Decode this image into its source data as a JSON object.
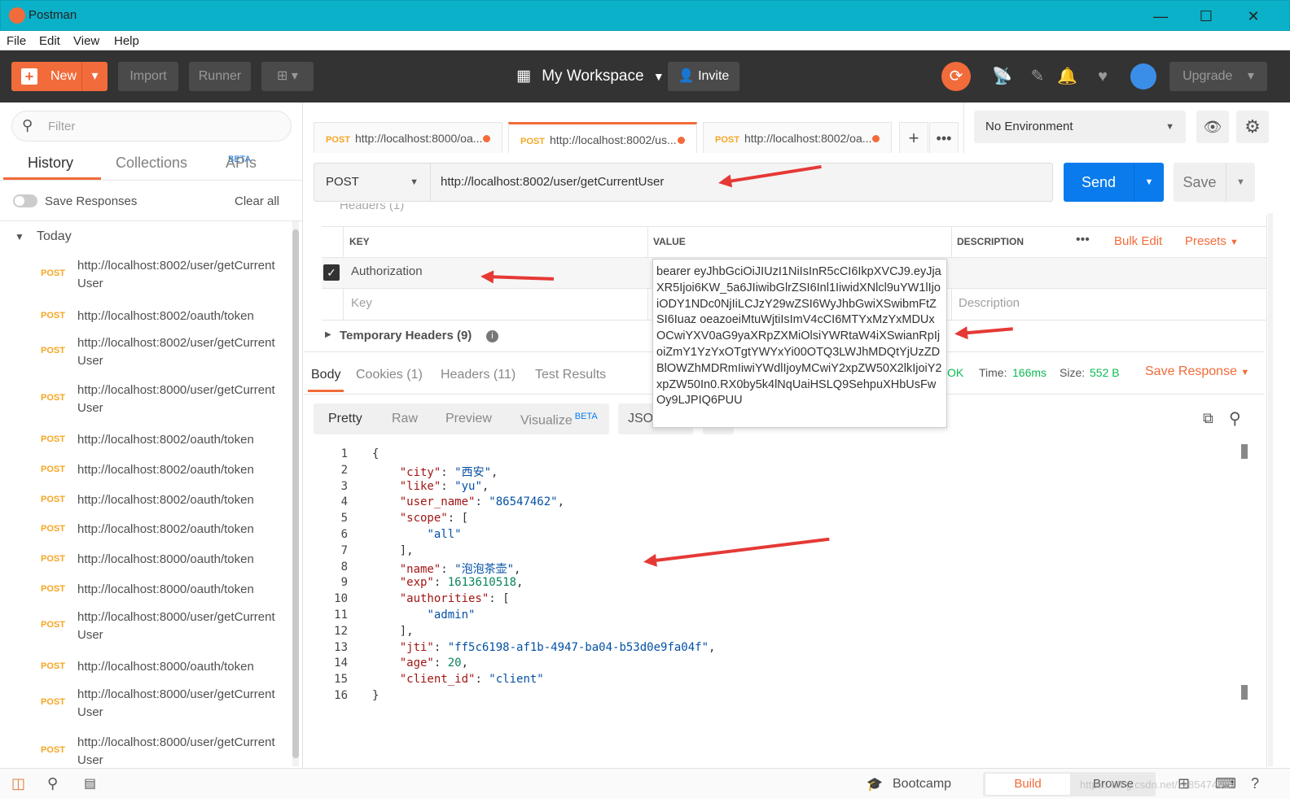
{
  "window": {
    "title": "Postman"
  },
  "menu": [
    "File",
    "Edit",
    "View",
    "Help"
  ],
  "header": {
    "new": "New",
    "import": "Import",
    "runner": "Runner",
    "workspace": "My Workspace",
    "invite": "Invite",
    "upgrade": "Upgrade"
  },
  "sidebar": {
    "filter_placeholder": "Filter",
    "tabs": [
      "History",
      "Collections",
      "APIs"
    ],
    "apis_badge": "BETA",
    "save_responses": "Save Responses",
    "clear_all": "Clear all",
    "group": "Today",
    "items": [
      {
        "method": "POST",
        "url": "http://localhost:8002/user/getCurrentUser"
      },
      {
        "method": "POST",
        "url": "http://localhost:8002/oauth/token"
      },
      {
        "method": "POST",
        "url": "http://localhost:8002/user/getCurrentUser"
      },
      {
        "method": "POST",
        "url": "http://localhost:8000/user/getCurrentUser"
      },
      {
        "method": "POST",
        "url": "http://localhost:8002/oauth/token"
      },
      {
        "method": "POST",
        "url": "http://localhost:8002/oauth/token"
      },
      {
        "method": "POST",
        "url": "http://localhost:8002/oauth/token"
      },
      {
        "method": "POST",
        "url": "http://localhost:8002/oauth/token"
      },
      {
        "method": "POST",
        "url": "http://localhost:8000/oauth/token"
      },
      {
        "method": "POST",
        "url": "http://localhost:8000/oauth/token"
      },
      {
        "method": "POST",
        "url": "http://localhost:8000/user/getCurrentUser"
      },
      {
        "method": "POST",
        "url": "http://localhost:8000/oauth/token"
      },
      {
        "method": "POST",
        "url": "http://localhost:8000/user/getCurrentUser"
      },
      {
        "method": "POST",
        "url": "http://localhost:8000/user/getCurrentUser"
      }
    ]
  },
  "tabs": [
    {
      "method": "POST",
      "url": "http://localhost:8000/oa..."
    },
    {
      "method": "POST",
      "url": "http://localhost:8002/us..."
    },
    {
      "method": "POST",
      "url": "http://localhost:8002/oa..."
    }
  ],
  "environment": "No Environment",
  "request": {
    "method": "POST",
    "url": "http://localhost:8002/user/getCurrentUser",
    "send": "Send",
    "save": "Save",
    "headers_label": "Headers (1)"
  },
  "headers_table": {
    "cols": [
      "KEY",
      "VALUE",
      "DESCRIPTION"
    ],
    "bulk_edit": "Bulk Edit",
    "presets": "Presets",
    "row_key": "Authorization",
    "key_placeholder": "Key",
    "desc_placeholder": "Description",
    "temporary": "Temporary Headers (9)"
  },
  "token_tooltip": "bearer eyJhbGciOiJIUzI1NiIsInR5cCI6IkpXVCJ9.eyJjaXR5Ijoi6KW_5a6JIiwibGlrZSI6Inl1IiwidXNlcl9uYW1lIjoiODY1NDc0NjIiLCJzY29wZSI6WyJhbGwiXSwibmFtZSI6Iuaz oeazoeiMtuWjtiIsImV4cCI6MTYxMzYxMDUxOCwiYXV0aG9yaXRpZXMiOlsiYWRtaW4iXSwianRpIjoiZmY1YzYxOTgtYWYxYi00OTQ3LWJhMDQtYjUzZDBlOWZhMDRmIiwiYWdlIjoyMCwiY2xpZW50X2lkIjoiY2xpZW50In0.RX0by5k4lNqUaiHSLQ9SehpuXHbUsFwOy9LJPIQ6PUU",
  "response": {
    "tabs": [
      "Body",
      "Cookies (1)",
      "Headers (11)",
      "Test Results"
    ],
    "status": "OK",
    "time_label": "Time:",
    "time": "166ms",
    "size_label": "Size:",
    "size": "552 B",
    "save_response": "Save Response",
    "view_tabs": [
      "Pretty",
      "Raw",
      "Preview",
      "Visualize"
    ],
    "visualize_badge": "BETA",
    "format": "JSON"
  },
  "json_lines": [
    "{",
    "    \"city\": \"西安\",",
    "    \"like\": \"yu\",",
    "    \"user_name\": \"86547462\",",
    "    \"scope\": [",
    "        \"all\"",
    "    ],",
    "    \"name\": \"泡泡茶壶\",",
    "    \"exp\": 1613610518,",
    "    \"authorities\": [",
    "        \"admin\"",
    "    ],",
    "    \"jti\": \"ff5c6198-af1b-4947-ba04-b53d0e9fa04f\",",
    "    \"age\": 20,",
    "    \"client_id\": \"client\"",
    "}"
  ],
  "statusbar": {
    "bootcamp": "Bootcamp",
    "build": "Build",
    "browse": "Browse",
    "watermark": "https://blog.csdn.net/zk8547462"
  },
  "colors": {
    "accent": "#f26b3a",
    "send": "#097bed",
    "titlebar": "#0bb1c9",
    "header": "#333333"
  }
}
